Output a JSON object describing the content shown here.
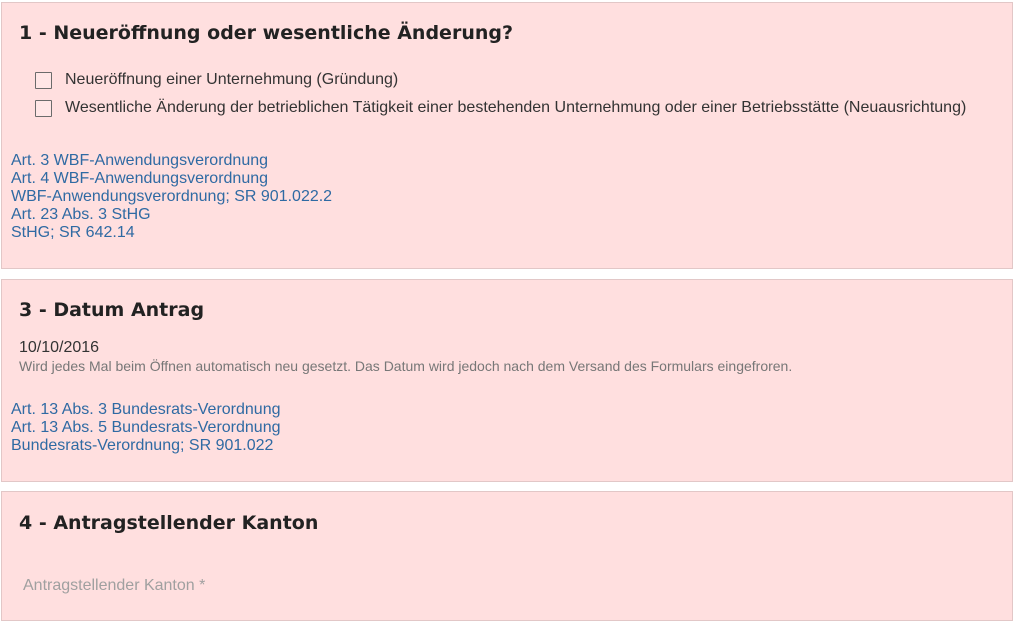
{
  "sections": [
    {
      "title": "1 - Neueröffnung oder wesentliche Änderung?",
      "options": [
        {
          "label": "Neueröffnung einer Unternehmung (Gründung)",
          "checked": false
        },
        {
          "label": "Wesentliche Änderung der betrieblichen Tätigkeit einer bestehenden Unternehmung oder einer Betriebsstätte (Neuausrichtung)",
          "checked": false
        }
      ],
      "links": [
        "Art. 3 WBF-Anwendungsverordnung",
        "Art. 4 WBF-Anwendungsverordnung",
        "WBF-Anwendungsverordnung; SR 901.022.2",
        "Art. 23 Abs. 3 StHG",
        "StHG; SR 642.14"
      ]
    },
    {
      "title": "3 - Datum Antrag",
      "date": "10/10/2016",
      "hint": "Wird jedes Mal beim Öffnen automatisch neu gesetzt. Das Datum wird jedoch nach dem Versand des Formulars eingefroren.",
      "links": [
        "Art. 13 Abs. 3 Bundesrats-Verordnung",
        "Art. 13 Abs. 5 Bundesrats-Verordnung",
        "Bundesrats-Verordnung; SR 901.022"
      ]
    },
    {
      "title": "4 - Antragstellender Kanton",
      "field_placeholder": "Antragstellender Kanton *",
      "field_value": ""
    }
  ],
  "colors": {
    "panel_bg": "#ffdfdf",
    "panel_border": "#e2c7c7",
    "link": "#2f6aa3",
    "hint": "#777777"
  }
}
